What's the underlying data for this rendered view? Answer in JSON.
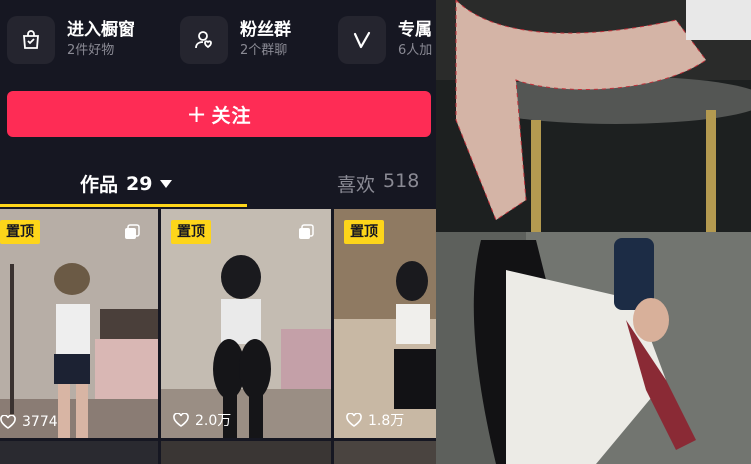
{
  "shortcuts": [
    {
      "title": "进入橱窗",
      "subtitle": "2件好物",
      "icon": "shopping-bag-icon"
    },
    {
      "title": "粉丝群",
      "subtitle": "2个群聊",
      "icon": "fan-group-icon"
    },
    {
      "title": "专属",
      "subtitle": "6人加",
      "icon": "v-icon"
    }
  ],
  "follow": {
    "plus": "+",
    "label": "关注"
  },
  "tabs": {
    "works": {
      "label": "作品",
      "count": "29"
    },
    "likes": {
      "label": "喜欢",
      "count": "518"
    }
  },
  "videos": [
    {
      "pinned": "置顶",
      "likes": "3774"
    },
    {
      "pinned": "置顶",
      "likes": "2.0万"
    },
    {
      "pinned": "置顶",
      "likes": "1.8万"
    }
  ],
  "colors": {
    "accent": "#fe2c55",
    "tab_indicator": "#fdd51a",
    "pin_badge": "#fdd51a",
    "background": "#161722"
  }
}
